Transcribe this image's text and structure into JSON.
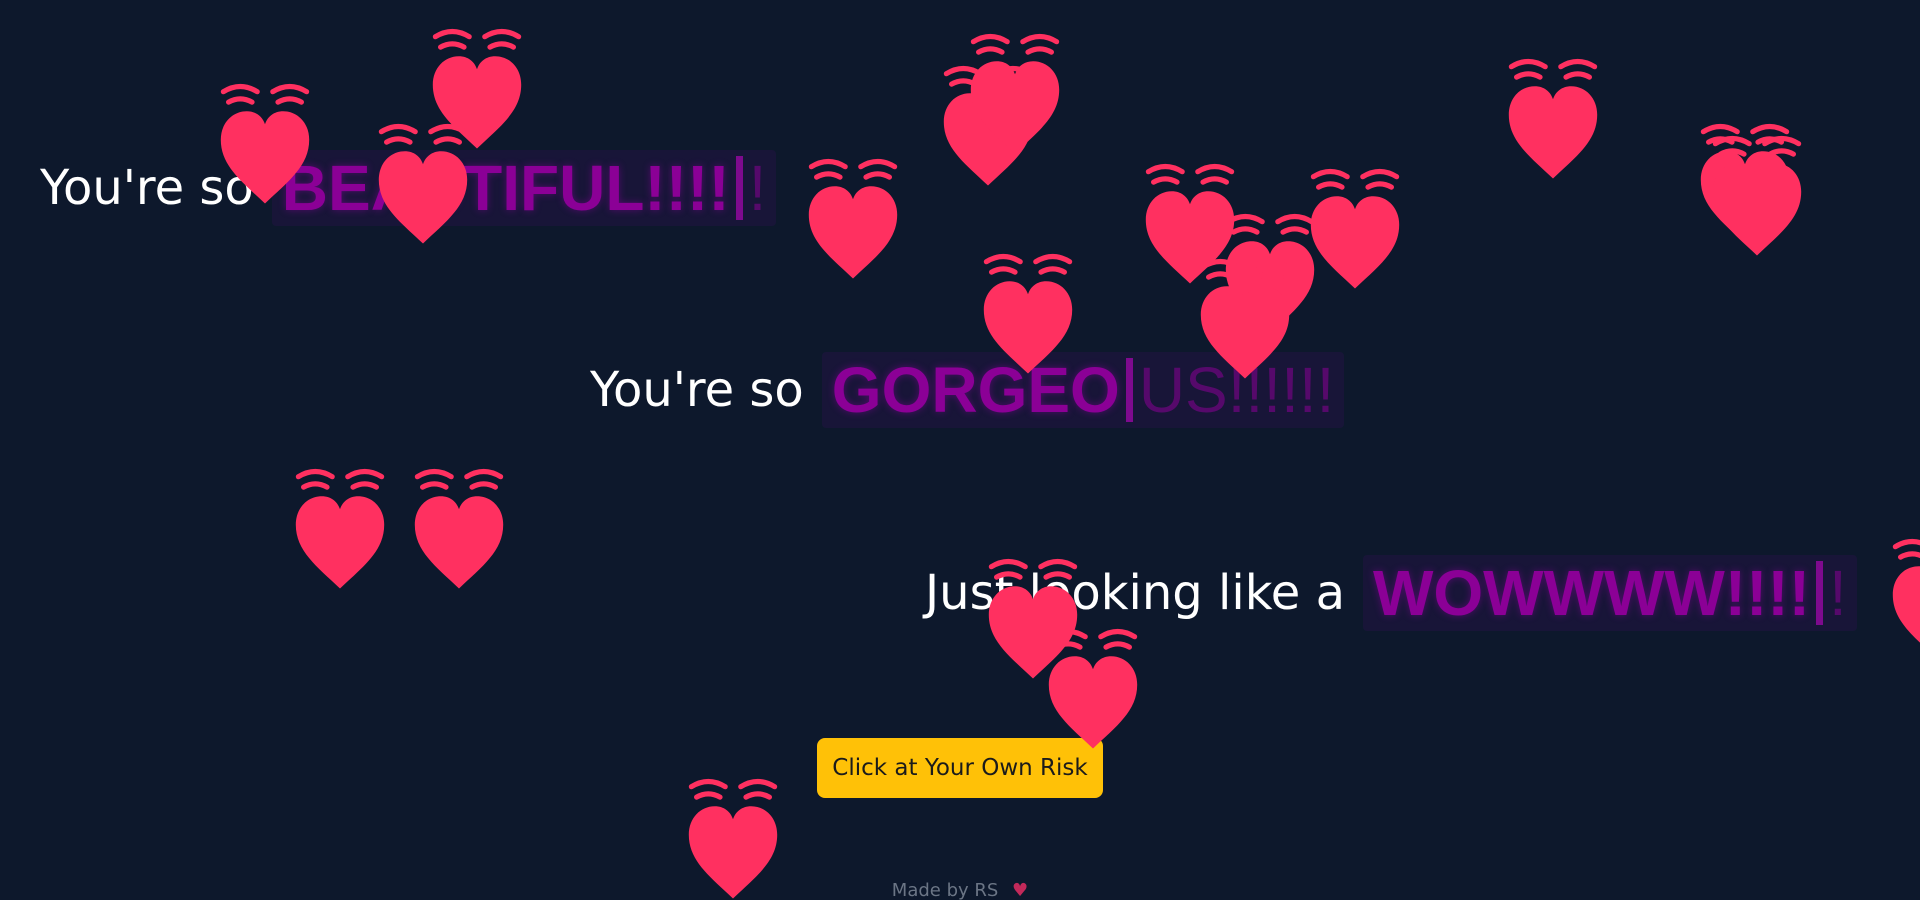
{
  "lines": [
    {
      "prefix": "You're so",
      "word": "BEAUTIFUL!!!!",
      "ghost": "!"
    },
    {
      "prefix": "You're so",
      "word": "GORGEO",
      "ghost": "US!!!!!!"
    },
    {
      "prefix": "Just looking like a",
      "word": "WOWWWW!!!!",
      "ghost": "!"
    }
  ],
  "button": {
    "label": "Click at Your Own Risk"
  },
  "footer": {
    "text": "Made by RS",
    "heart": "♥"
  },
  "colors": {
    "background": "#0d182c",
    "text": "#ffffff",
    "typed_word": "#8b0096",
    "button": "#ffc107",
    "heart": "#ff3060"
  },
  "decoration_icon": "beating-heart-icon"
}
